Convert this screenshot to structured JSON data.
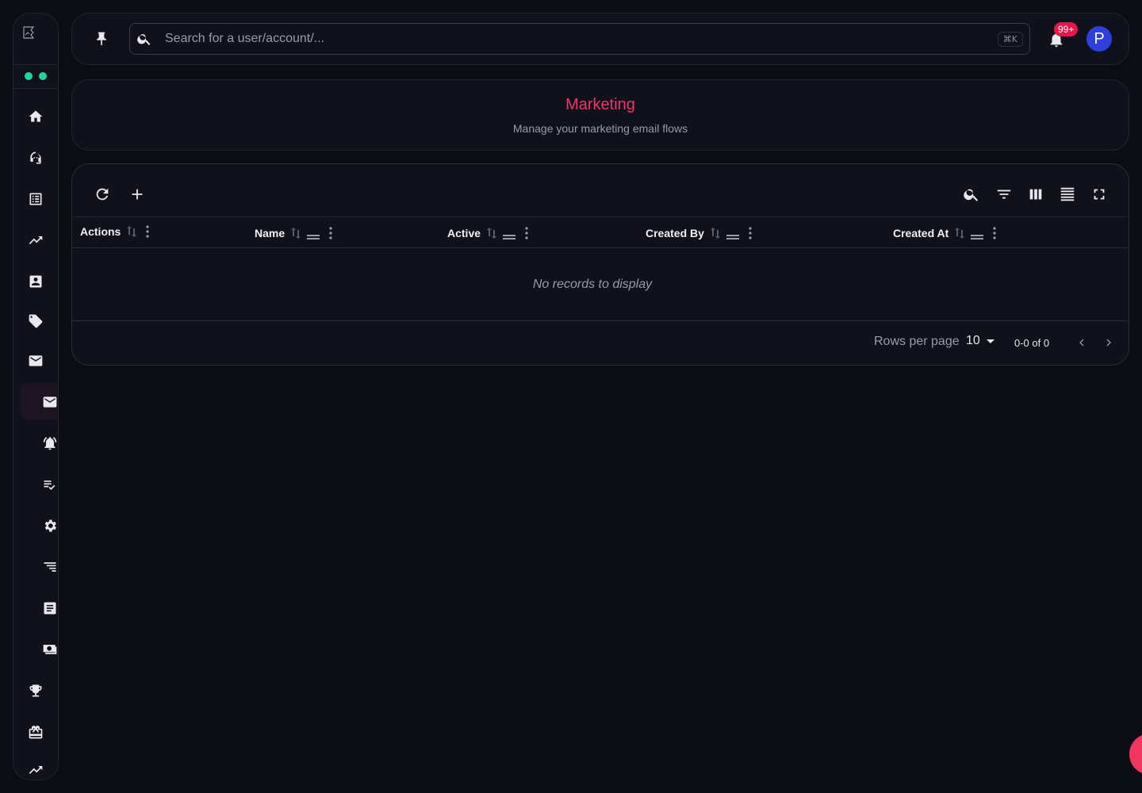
{
  "colors": {
    "background": "#0b0c14",
    "panel": "#10111b",
    "accent": "#f0356a",
    "status_dot": "#1ed6a0",
    "badge": "#e8154b",
    "avatar": "#2f3fdc",
    "fab": "#f0355f"
  },
  "sidebar": {
    "items": [
      {
        "icon": "home-icon"
      },
      {
        "icon": "support-agent-icon"
      },
      {
        "icon": "list-alt-icon"
      },
      {
        "icon": "trending-up-icon"
      },
      {
        "icon": "contact-card-icon"
      },
      {
        "icon": "tag-icon"
      },
      {
        "icon": "mail-icon"
      },
      {
        "icon": "mail-icon",
        "active": true
      },
      {
        "icon": "notification-alarm-icon"
      },
      {
        "icon": "playlist-check-icon"
      },
      {
        "icon": "settings-gear-icon"
      },
      {
        "icon": "sort-lines-icon"
      },
      {
        "icon": "article-icon"
      },
      {
        "icon": "money-icon"
      },
      {
        "icon": "trophy-icon"
      },
      {
        "icon": "gift-box-icon"
      },
      {
        "icon": "trending-up-icon"
      }
    ]
  },
  "topbar": {
    "search_placeholder": "Search for a user/account/...",
    "search_shortcut": "⌘K",
    "notification_count": "99+",
    "avatar_initial": "P"
  },
  "header": {
    "title": "Marketing",
    "subtitle": "Manage your marketing email flows"
  },
  "table": {
    "columns": [
      {
        "label": "Actions"
      },
      {
        "label": "Name"
      },
      {
        "label": "Active"
      },
      {
        "label": "Created By"
      },
      {
        "label": "Created At"
      }
    ],
    "empty_text": "No records to display",
    "rows_per_page_label": "Rows per page",
    "rows_per_page_value": "10",
    "range_text": "0-0 of 0"
  }
}
